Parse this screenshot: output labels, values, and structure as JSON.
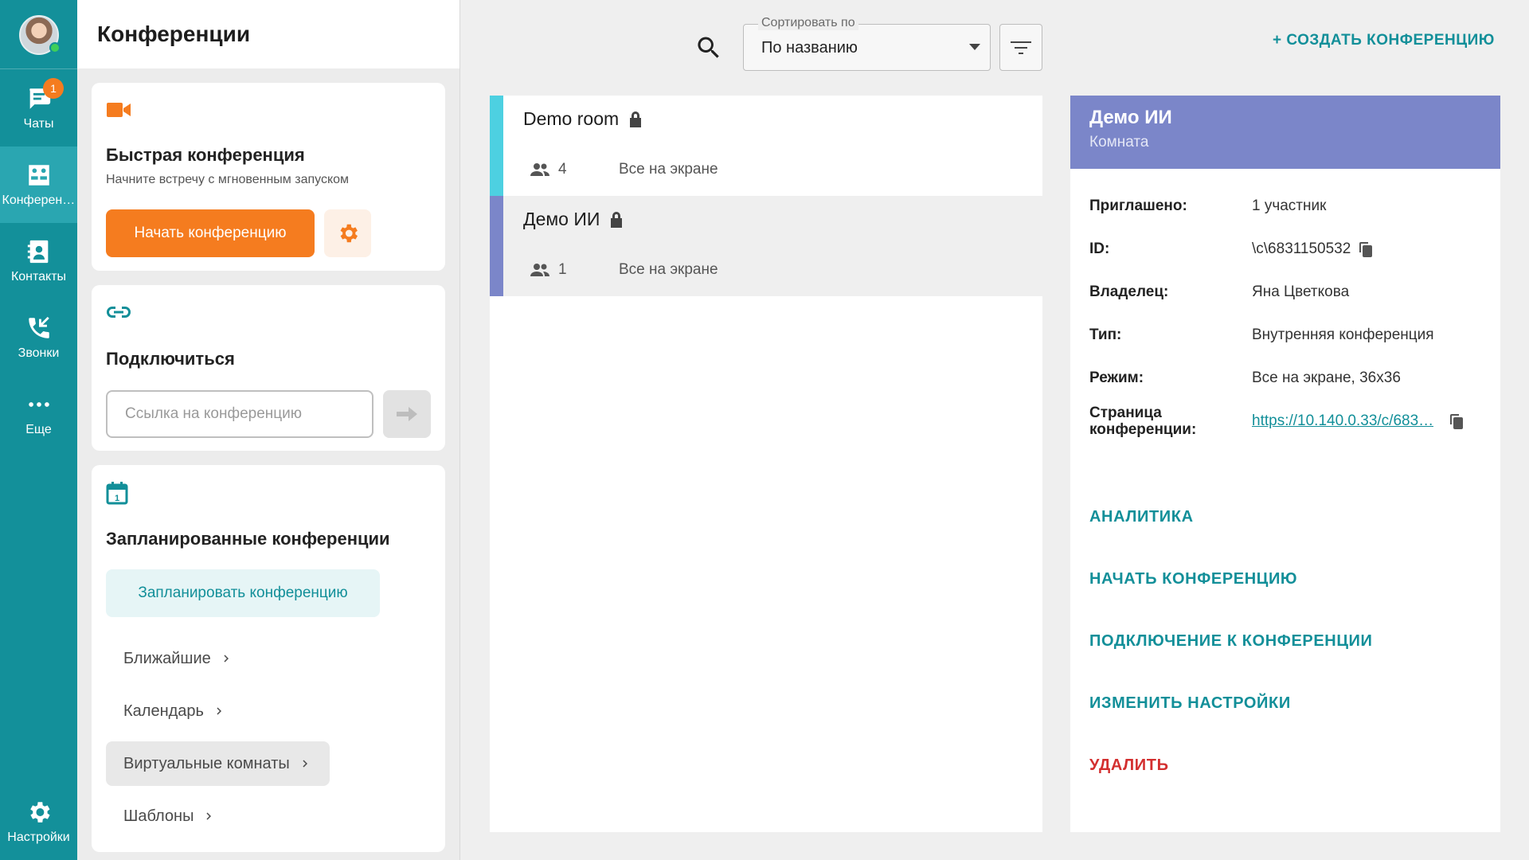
{
  "rail": {
    "items": [
      {
        "label": "Чаты",
        "badge": "1"
      },
      {
        "label": "Конференции"
      },
      {
        "label": "Контакты"
      },
      {
        "label": "Звонки"
      },
      {
        "label": "Еще"
      },
      {
        "label": "Настройки"
      }
    ]
  },
  "side": {
    "title": "Конференции",
    "quick": {
      "title": "Быстрая конференция",
      "subtitle": "Начните встречу с мгновенным запуском",
      "start_label": "Начать конференцию"
    },
    "connect": {
      "title": "Подключиться",
      "placeholder": "Ссылка на конференцию"
    },
    "scheduled": {
      "title": "Запланированные конференции",
      "schedule_label": "Запланировать конференцию",
      "links": [
        "Ближайшие",
        "Календарь",
        "Виртуальные комнаты",
        "Шаблоны"
      ]
    }
  },
  "main": {
    "sort_caption": "Сортировать по",
    "sort_value": "По названию",
    "create_label": "+ СОЗДАТЬ КОНФЕРЕНЦИЮ",
    "rooms": [
      {
        "name": "Demo room",
        "participants": "4",
        "mode": "Все на экране",
        "color": "#4dd0e1"
      },
      {
        "name": "Демо ИИ",
        "participants": "1",
        "mode": "Все на экране",
        "color": "#7b86c9"
      }
    ]
  },
  "detail": {
    "title": "Демо ИИ",
    "subtitle": "Комната",
    "fields": {
      "invited_k": "Приглашено:",
      "invited_v": "1 участник",
      "id_k": "ID:",
      "id_v": "\\c\\6831150532",
      "owner_k": "Владелец:",
      "owner_v": "Яна Цветкова",
      "type_k": "Тип:",
      "type_v": "Внутренняя конференция",
      "mode_k": "Режим:",
      "mode_v": "Все на экране, 36x36",
      "page_k": "Страница конференции:",
      "page_v": "https://10.140.0.33/c/683…"
    },
    "actions": {
      "analytics": "АНАЛИТИКА",
      "start": "НАЧАТЬ КОНФЕРЕНЦИЮ",
      "join": "ПОДКЛЮЧЕНИЕ К КОНФЕРЕНЦИИ",
      "settings": "ИЗМЕНИТЬ НАСТРОЙКИ",
      "delete": "УДАЛИТЬ"
    }
  },
  "colors": {
    "teal": "#13909a",
    "orange": "#f57c1f",
    "accent": "#7b86c9",
    "danger": "#d32f2f"
  }
}
